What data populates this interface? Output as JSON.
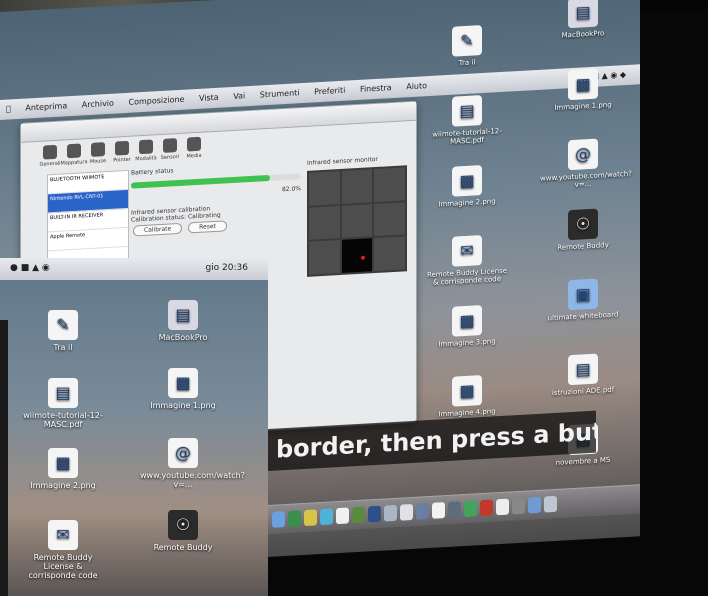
{
  "menubar": {
    "items": [
      "Anteprima",
      "Archivio",
      "Composizione",
      "Vista",
      "Vai",
      "Strumenti",
      "Preferiti",
      "Finestra",
      "Aiuto"
    ]
  },
  "window": {
    "toolbar": [
      "Generali",
      "Mappatura",
      "Mouse",
      "Pointer",
      "Modalità",
      "Sensori",
      "Media"
    ],
    "sidebar": [
      "BLUETOOTH WIIMOTE",
      "Nintendo RVL-CNT-01",
      "BUILT-IN IR RECEIVER",
      "Apple Remote"
    ],
    "battery_label": "Battery status",
    "battery_value": "82.0%",
    "battery_level": 0.82,
    "ir_label": "Infrared sensor calibration",
    "status_label": "Calibration status:",
    "status_value": "Calibrating",
    "calibrate_button": "Calibrate",
    "reset_button": "Reset",
    "sensor_title": "Infrared sensor monitor"
  },
  "desktop_icons": [
    {
      "name": "MacBookPro",
      "icon": "hard-drive-icon"
    },
    {
      "name": "Tra il",
      "icon": "document-icon"
    },
    {
      "name": "Immagine 1.png",
      "icon": "image-icon"
    },
    {
      "name": "wiimote-tutorial-12-MASC.pdf",
      "icon": "pdf-icon"
    },
    {
      "name": "Immagine 2.png",
      "icon": "image-icon"
    },
    {
      "name": "www.youtube.com/watch?v=...",
      "icon": "webloc-icon"
    },
    {
      "name": "Remote Buddy License & corrisponde code",
      "icon": "license-icon"
    },
    {
      "name": "Remote Buddy",
      "icon": "app-icon"
    },
    {
      "name": "Immagine 3.png",
      "icon": "image-icon"
    },
    {
      "name": "ultimate whiteboard",
      "icon": "folder-icon"
    },
    {
      "name": "Immagine 4.png",
      "icon": "image-icon"
    },
    {
      "name": "istruzioni ADE.pdf",
      "icon": "pdf-icon"
    },
    {
      "name": "novembre a MS",
      "icon": "document-icon"
    }
  ],
  "caption": "border, then press a button.",
  "overlay": {
    "clock": "gio 20:36",
    "icons": [
      {
        "name": "Tra il",
        "icon": "document-icon"
      },
      {
        "name": "MacBookPro",
        "icon": "hard-drive-icon"
      },
      {
        "name": "wiimote-tutorial-12-MASC.pdf",
        "icon": "pdf-icon"
      },
      {
        "name": "Immagine 1.png",
        "icon": "image-icon"
      },
      {
        "name": "Immagine 2.png",
        "icon": "image-icon"
      },
      {
        "name": "www.youtube.com/watch?v=...",
        "icon": "webloc-icon"
      },
      {
        "name": "Remote Buddy License & corrisponde code",
        "icon": "license-icon"
      },
      {
        "name": "Remote Buddy",
        "icon": "app-icon"
      }
    ]
  },
  "colors": {
    "accent": "#3fc24f",
    "selection": "#2b64c9",
    "sensor_dot": "#e01b1b"
  }
}
